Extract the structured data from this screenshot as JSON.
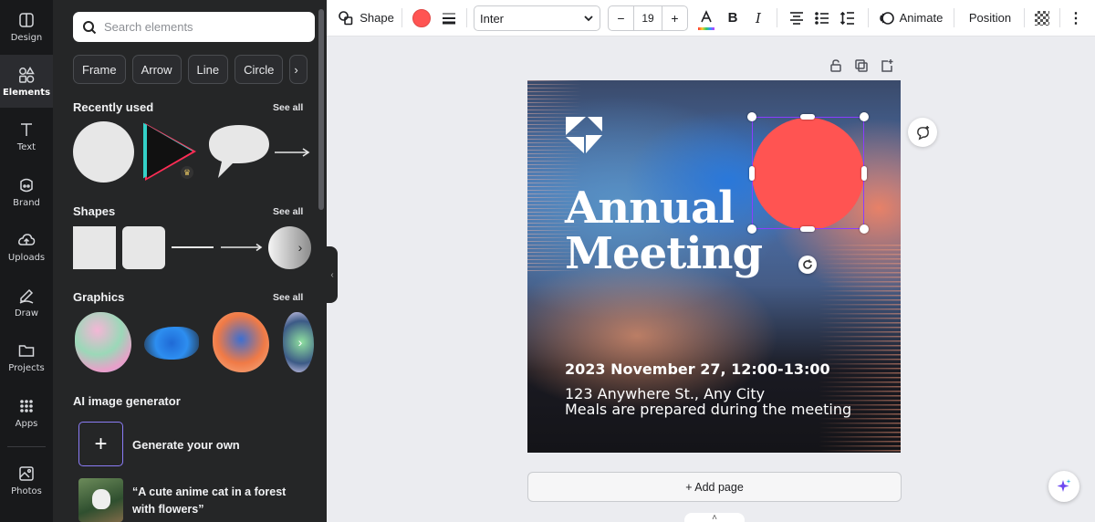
{
  "rail": {
    "items": [
      {
        "label": "Design",
        "icon": "design-icon"
      },
      {
        "label": "Elements",
        "icon": "elements-icon"
      },
      {
        "label": "Text",
        "icon": "text-icon"
      },
      {
        "label": "Brand",
        "icon": "brand-icon"
      },
      {
        "label": "Uploads",
        "icon": "uploads-icon"
      },
      {
        "label": "Draw",
        "icon": "draw-icon"
      },
      {
        "label": "Projects",
        "icon": "projects-icon"
      },
      {
        "label": "Apps",
        "icon": "apps-icon"
      },
      {
        "label": "Photos",
        "icon": "photos-icon"
      }
    ],
    "active": "Elements"
  },
  "panel": {
    "search_placeholder": "Search elements",
    "chips": [
      "Frame",
      "Arrow",
      "Line",
      "Circle"
    ],
    "recently_used": {
      "title": "Recently used",
      "see_all": "See all"
    },
    "shapes": {
      "title": "Shapes",
      "see_all": "See all"
    },
    "graphics": {
      "title": "Graphics",
      "see_all": "See all"
    },
    "ai": {
      "title": "AI image generator",
      "generate_label": "Generate your own",
      "example_prompt": "“A cute anime cat in a forest with flowers”"
    }
  },
  "toolbar": {
    "shape_label": "Shape",
    "fill_color": "#ff5452",
    "font": "Inter",
    "font_size": "19",
    "minus": "−",
    "plus": "+",
    "animate_label": "Animate",
    "position_label": "Position",
    "more": "⋮"
  },
  "design": {
    "title_line1": "Annual",
    "title_line2": "Meeting",
    "date": "2023 November 27, 12:00-13:00",
    "address": "123 Anywhere St., Any City",
    "note": "Meals are prepared during the meeting"
  },
  "canvas": {
    "add_page": "+ Add page"
  },
  "colors": {
    "accent": "#8b3dff",
    "panel_bg": "#252627",
    "rail_bg": "#18191b",
    "shape_red": "#ff5452"
  }
}
